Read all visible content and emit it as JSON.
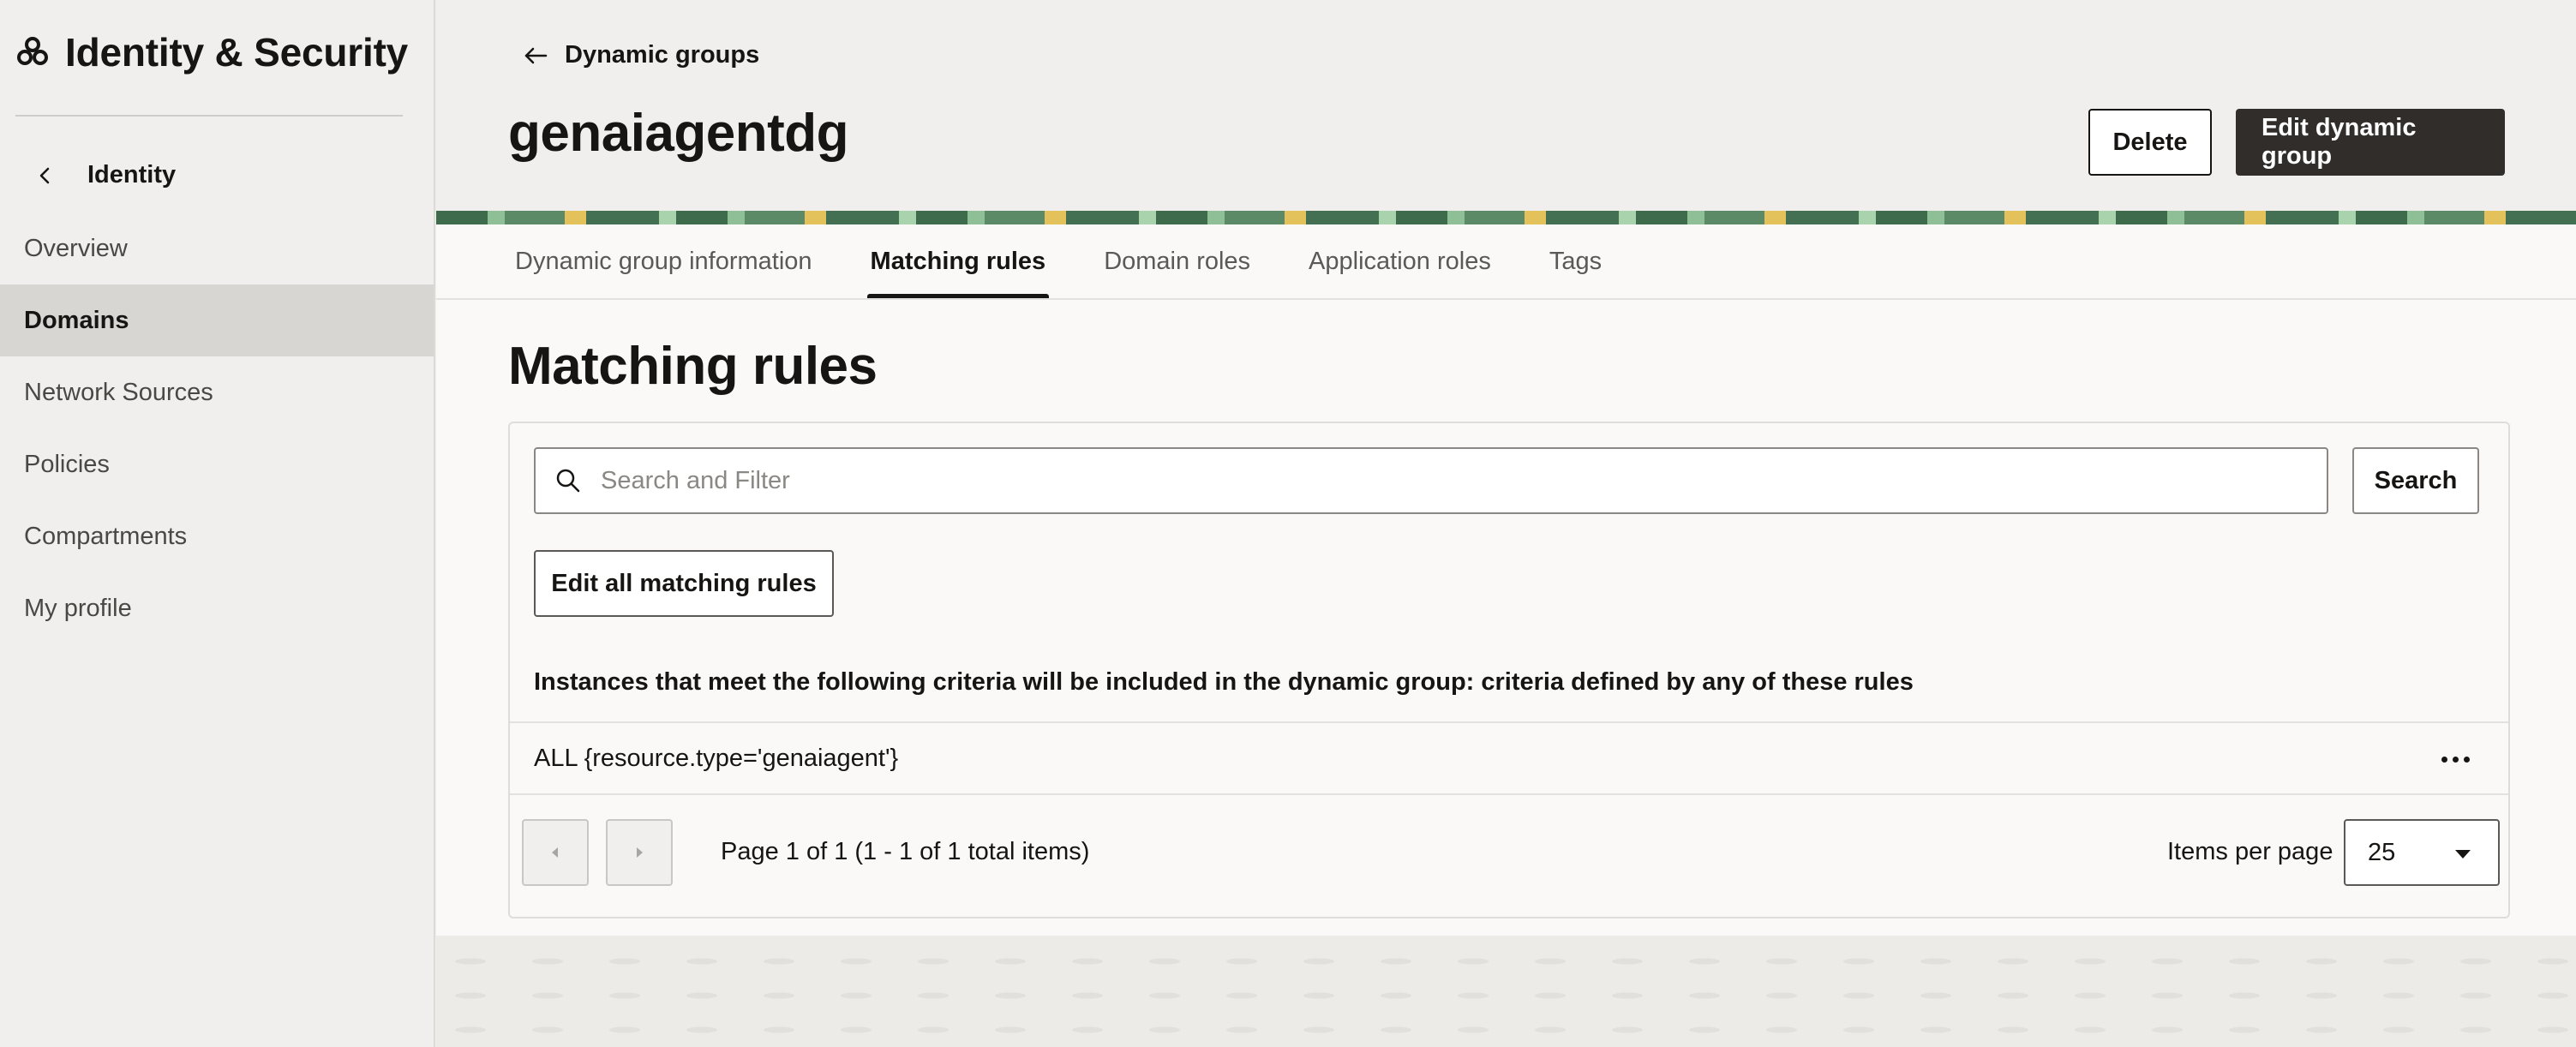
{
  "sidebar": {
    "brand_title": "Identity & Security",
    "brand_icon": "oci-logo-icon",
    "back_label": "Identity",
    "items": [
      {
        "label": "Overview",
        "active": false
      },
      {
        "label": "Domains",
        "active": true
      },
      {
        "label": "Network Sources",
        "active": false
      },
      {
        "label": "Policies",
        "active": false
      },
      {
        "label": "Compartments",
        "active": false
      },
      {
        "label": "My profile",
        "active": false
      }
    ]
  },
  "header": {
    "back_label": "Dynamic groups",
    "title": "genaiagentdg",
    "delete_label": "Delete",
    "edit_label": "Edit dynamic group"
  },
  "tabs": [
    {
      "label": "Dynamic group information",
      "active": false
    },
    {
      "label": "Matching rules",
      "active": true
    },
    {
      "label": "Domain roles",
      "active": false
    },
    {
      "label": "Application roles",
      "active": false
    },
    {
      "label": "Tags",
      "active": false
    }
  ],
  "section": {
    "title": "Matching rules",
    "search_placeholder": "Search and Filter",
    "search_button": "Search",
    "edit_all_label": "Edit all matching rules",
    "criteria_text": "Instances that meet the following criteria will be included in the dynamic group: criteria defined by any of these rules",
    "rules": [
      {
        "text": "ALL {resource.type='genaiagent'}"
      }
    ]
  },
  "pagination": {
    "page_text": "Page 1 of 1 (1 - 1 of 1 total items)",
    "items_per_page_label": "Items per page",
    "items_per_page_value": "25"
  },
  "colors": {
    "primary_button": "#312d2a",
    "active_nav": "#d8d6d3",
    "page_bg": "#f1efed"
  }
}
